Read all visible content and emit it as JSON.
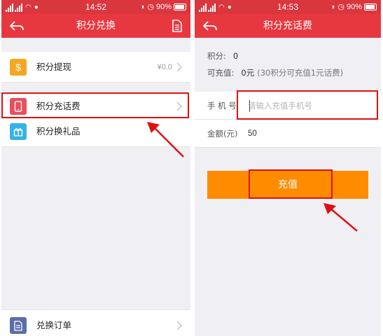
{
  "status_left": {
    "time": "14:52",
    "battery": "90%"
  },
  "status_right": {
    "time": "14:53",
    "battery": "90%"
  },
  "left": {
    "title": "积分兑换",
    "items": [
      {
        "label": "积分提现",
        "value": "¥0.0"
      },
      {
        "label": "积分充话费",
        "value": ""
      },
      {
        "label": "积分换礼品",
        "value": ""
      }
    ],
    "bottom_item": {
      "label": "兑换订单"
    }
  },
  "right": {
    "title": "积分充话费",
    "points_label": "积分:",
    "points_value": "0",
    "rechargeable_label": "可充值:",
    "rechargeable_value": "0元",
    "rechargeable_note": "(30积分可充值1元话费)",
    "phone_label": "手 机 号",
    "phone_placeholder": "请输入充值手机号",
    "amount_label": "金额(元)",
    "amount_value": "50",
    "submit_label": "充值"
  },
  "colors": {
    "status_bar": "#d9363e",
    "title_bar": "#e8383f",
    "button": "#ff8c00",
    "highlight": "#e01010"
  },
  "icons": {
    "withdraw": "dollar-icon",
    "recharge": "phone-icon",
    "gift": "gift-icon",
    "orders": "document-icon"
  }
}
